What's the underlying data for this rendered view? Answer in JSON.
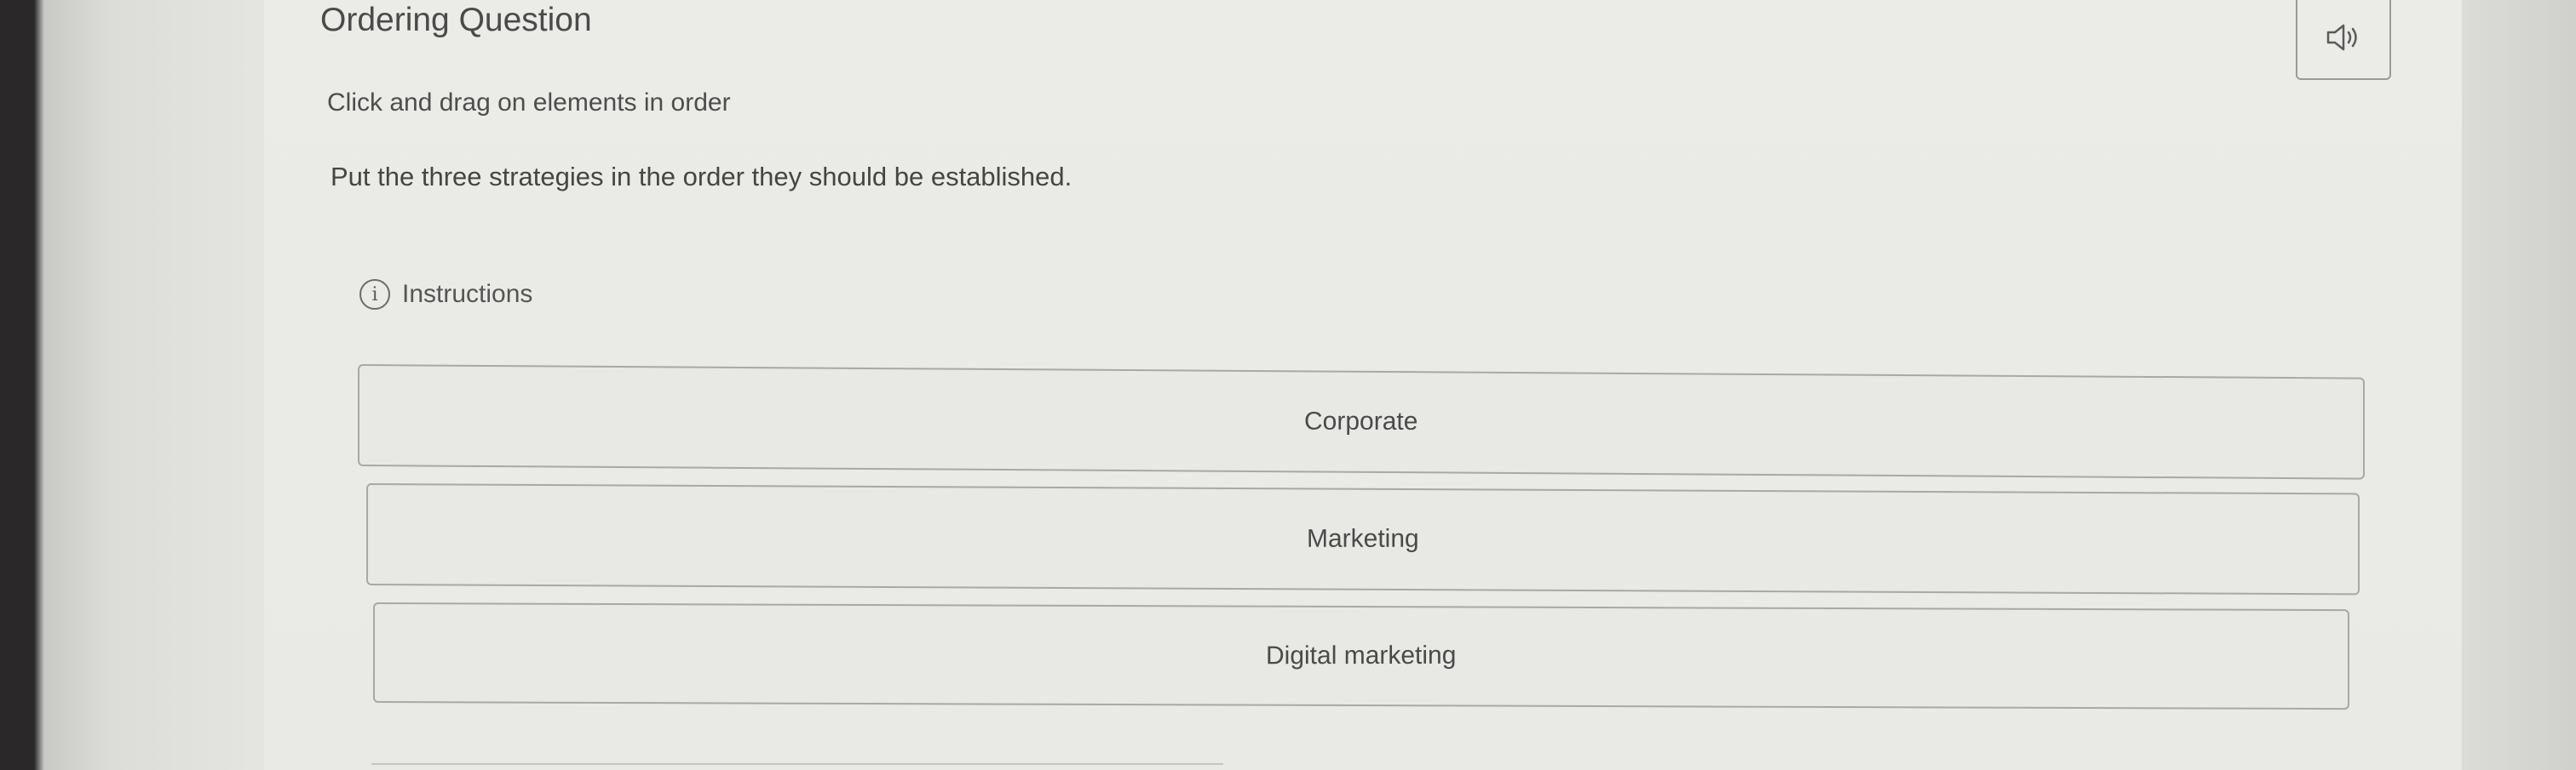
{
  "header": {
    "title": "Ordering Question",
    "audio_icon": "speaker-icon"
  },
  "question": {
    "instruction": "Click and drag on elements in order",
    "prompt": "Put the three strategies in the order they should be established."
  },
  "instructions_toggle": {
    "icon": "info-icon",
    "label": "Instructions"
  },
  "items": [
    {
      "label": "Corporate"
    },
    {
      "label": "Marketing"
    },
    {
      "label": "Digital marketing"
    }
  ]
}
